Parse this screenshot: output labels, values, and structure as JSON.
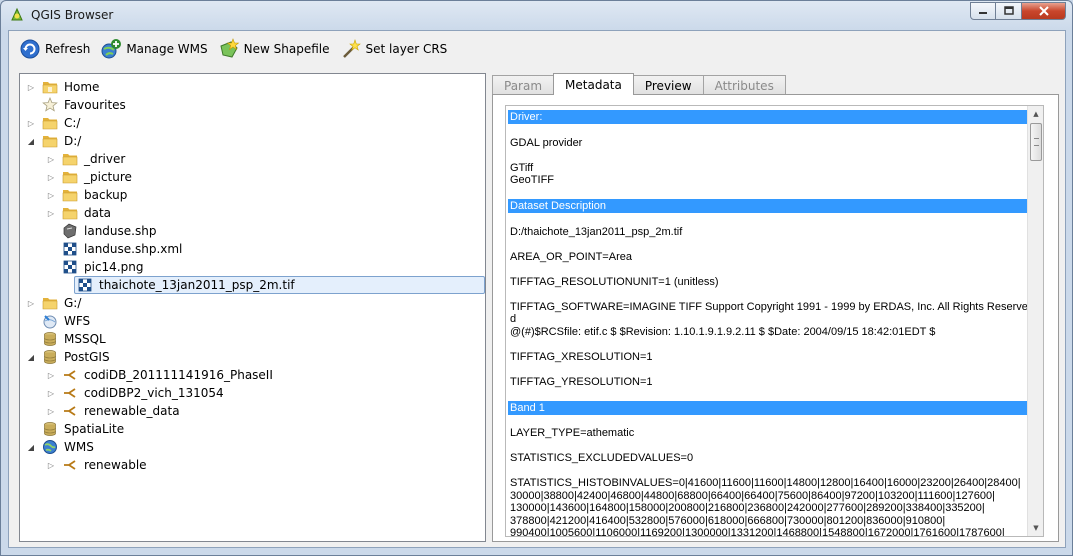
{
  "window": {
    "title": "QGIS Browser"
  },
  "toolbar": {
    "refresh": "Refresh",
    "manage_wms": "Manage WMS",
    "new_shapefile": "New Shapefile",
    "set_layer_crs": "Set layer CRS"
  },
  "tree": {
    "items": [
      {
        "label": "Home",
        "icon": "folder-home-icon",
        "level": 0,
        "expander": "collapsed"
      },
      {
        "label": "Favourites",
        "icon": "star-icon",
        "level": 0,
        "expander": "none"
      },
      {
        "label": "C:/",
        "icon": "folder-icon",
        "level": 0,
        "expander": "collapsed"
      },
      {
        "label": "D:/",
        "icon": "folder-icon",
        "level": 0,
        "expander": "expanded"
      },
      {
        "label": "_driver",
        "icon": "folder-icon",
        "level": 1,
        "expander": "collapsed"
      },
      {
        "label": "_picture",
        "icon": "folder-icon",
        "level": 1,
        "expander": "collapsed"
      },
      {
        "label": "backup",
        "icon": "folder-icon",
        "level": 1,
        "expander": "collapsed"
      },
      {
        "label": "data",
        "icon": "folder-icon",
        "level": 1,
        "expander": "collapsed"
      },
      {
        "label": "landuse.shp",
        "icon": "vector-layer-icon",
        "level": 1,
        "expander": "none"
      },
      {
        "label": "landuse.shp.xml",
        "icon": "raster-layer-icon",
        "level": 1,
        "expander": "none"
      },
      {
        "label": "pic14.png",
        "icon": "raster-layer-icon",
        "level": 1,
        "expander": "none"
      },
      {
        "label": "thaichote_13jan2011_psp_2m.tif",
        "icon": "raster-layer-icon",
        "level": 1,
        "expander": "none",
        "selected": true
      },
      {
        "label": "G:/",
        "icon": "folder-icon",
        "level": 0,
        "expander": "collapsed"
      },
      {
        "label": "WFS",
        "icon": "wfs-icon",
        "level": 0,
        "expander": "none"
      },
      {
        "label": "MSSQL",
        "icon": "database-icon",
        "level": 0,
        "expander": "none"
      },
      {
        "label": "PostGIS",
        "icon": "database-icon",
        "level": 0,
        "expander": "expanded"
      },
      {
        "label": "codiDB_201111141916_PhaseII",
        "icon": "connection-icon",
        "level": 1,
        "expander": "collapsed"
      },
      {
        "label": "codiDBP2_vich_131054",
        "icon": "connection-icon",
        "level": 1,
        "expander": "collapsed"
      },
      {
        "label": "renewable_data",
        "icon": "connection-icon",
        "level": 1,
        "expander": "collapsed"
      },
      {
        "label": "SpatiaLite",
        "icon": "database-icon",
        "level": 0,
        "expander": "none"
      },
      {
        "label": "WMS",
        "icon": "globe-icon",
        "level": 0,
        "expander": "expanded"
      },
      {
        "label": "renewable",
        "icon": "connection-icon",
        "level": 1,
        "expander": "collapsed"
      }
    ]
  },
  "tabs": [
    {
      "label": "Param",
      "state": "disabled"
    },
    {
      "label": "Metadata",
      "state": "active"
    },
    {
      "label": "Preview",
      "state": "enabled"
    },
    {
      "label": "Attributes",
      "state": "disabled"
    }
  ],
  "metadata": [
    {
      "type": "section",
      "text": "Driver:"
    },
    {
      "type": "gap"
    },
    {
      "type": "line",
      "text": "GDAL provider"
    },
    {
      "type": "gap"
    },
    {
      "type": "line",
      "text": "GTiff"
    },
    {
      "type": "line",
      "text": "GeoTIFF"
    },
    {
      "type": "gap"
    },
    {
      "type": "section",
      "text": "Dataset Description"
    },
    {
      "type": "gap"
    },
    {
      "type": "line",
      "text": "D:/thaichote_13jan2011_psp_2m.tif"
    },
    {
      "type": "gap"
    },
    {
      "type": "line",
      "text": "AREA_OR_POINT=Area"
    },
    {
      "type": "gap"
    },
    {
      "type": "line",
      "text": "TIFFTAG_RESOLUTIONUNIT=1 (unitless)"
    },
    {
      "type": "gap"
    },
    {
      "type": "line",
      "text": "TIFFTAG_SOFTWARE=IMAGINE TIFF Support Copyright 1991 - 1999 by ERDAS, Inc. All Rights Reserved"
    },
    {
      "type": "line",
      "text": "@(#)$RCSfile: etif.c $ $Revision: 1.10.1.9.1.9.2.11 $ $Date: 2004/09/15 18:42:01EDT $"
    },
    {
      "type": "gap"
    },
    {
      "type": "line",
      "text": "TIFFTAG_XRESOLUTION=1"
    },
    {
      "type": "gap"
    },
    {
      "type": "line",
      "text": "TIFFTAG_YRESOLUTION=1"
    },
    {
      "type": "gap"
    },
    {
      "type": "section",
      "text": "Band 1"
    },
    {
      "type": "gap"
    },
    {
      "type": "line",
      "text": "LAYER_TYPE=athematic"
    },
    {
      "type": "gap"
    },
    {
      "type": "line",
      "text": "STATISTICS_EXCLUDEDVALUES=0"
    },
    {
      "type": "gap"
    },
    {
      "type": "line",
      "text": "STATISTICS_HISTOBINVALUES=0|41600|11600|11600|14800|12800|16400|16000|23200|26400|28400|"
    },
    {
      "type": "line",
      "text": "30000|38800|42400|46800|44800|68800|66400|66400|75600|86400|97200|103200|111600|127600|"
    },
    {
      "type": "line",
      "text": "130000|143600|164800|158000|200800|216800|236800|242000|277600|289200|338400|335200|"
    },
    {
      "type": "line",
      "text": "378800|421200|416400|532800|576000|618000|666800|730000|801200|836000|910800|"
    },
    {
      "type": "line",
      "text": "990400|1005600|1106000|1169200|1300000|1331200|1468800|1548800|1672000|1761600|1787600|"
    }
  ],
  "colors": {
    "selection_blue": "#3399ff",
    "folder_yellow": "#f2c94c",
    "tree_selection": "#e4effc"
  }
}
